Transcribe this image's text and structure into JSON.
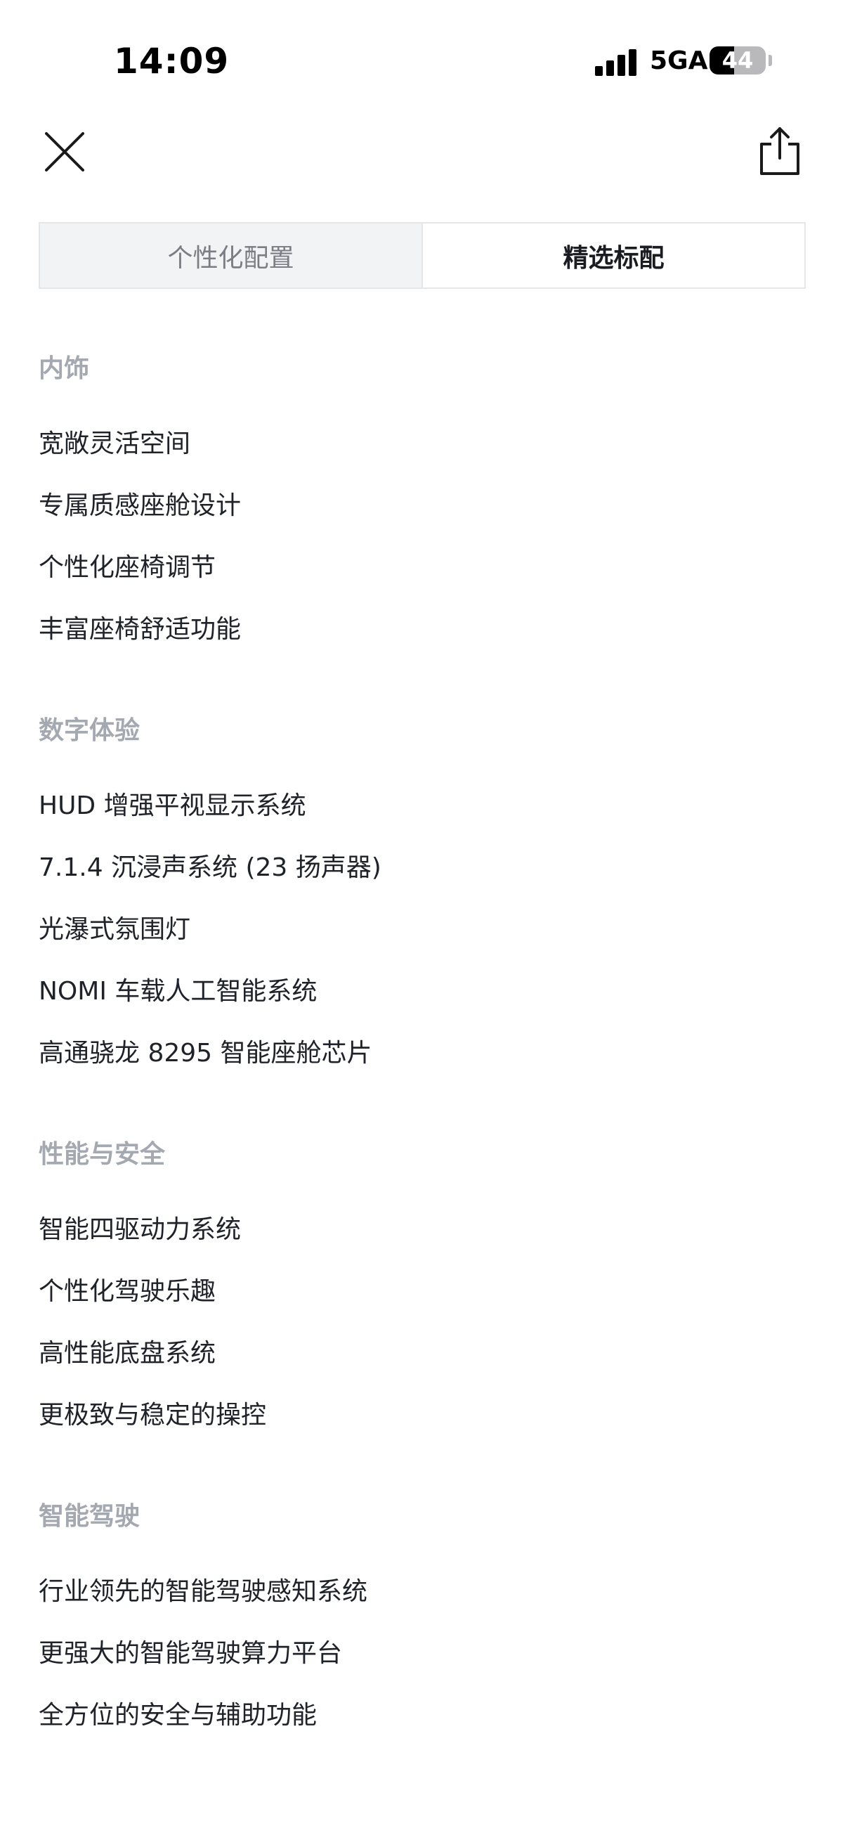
{
  "status_bar": {
    "time": "14:09",
    "network": "5GA",
    "battery": "44",
    "battery_level": 0.44
  },
  "nav": {
    "close_icon": "close-icon",
    "share_icon": "share-icon"
  },
  "tabs": [
    {
      "label": "个性化配置",
      "active": false
    },
    {
      "label": "精选标配",
      "active": true
    }
  ],
  "sections": [
    {
      "title": "内饰",
      "items": [
        "宽敞灵活空间",
        "专属质感座舱设计",
        "个性化座椅调节",
        "丰富座椅舒适功能"
      ]
    },
    {
      "title": "数字体验",
      "items": [
        "HUD 增强平视显示系统",
        "7.1.4 沉浸声系统 (23 扬声器)",
        "光瀑式氛围灯",
        "NOMI 车载人工智能系统",
        "高通骁龙 8295 智能座舱芯片"
      ]
    },
    {
      "title": "性能与安全",
      "items": [
        "智能四驱动力系统",
        "个性化驾驶乐趣",
        "高性能底盘系统",
        "更极致与稳定的操控"
      ]
    },
    {
      "title": "智能驾驶",
      "items": [
        "行业领先的智能驾驶感知系统",
        "更强大的智能驾驶算力平台",
        "全方位的安全与辅助功能"
      ]
    }
  ],
  "colors": {
    "section_title": "#a4a8b0",
    "item_text": "#1f2329",
    "tab_inactive_bg": "#f2f3f5",
    "tab_border": "#e5e6e8"
  }
}
